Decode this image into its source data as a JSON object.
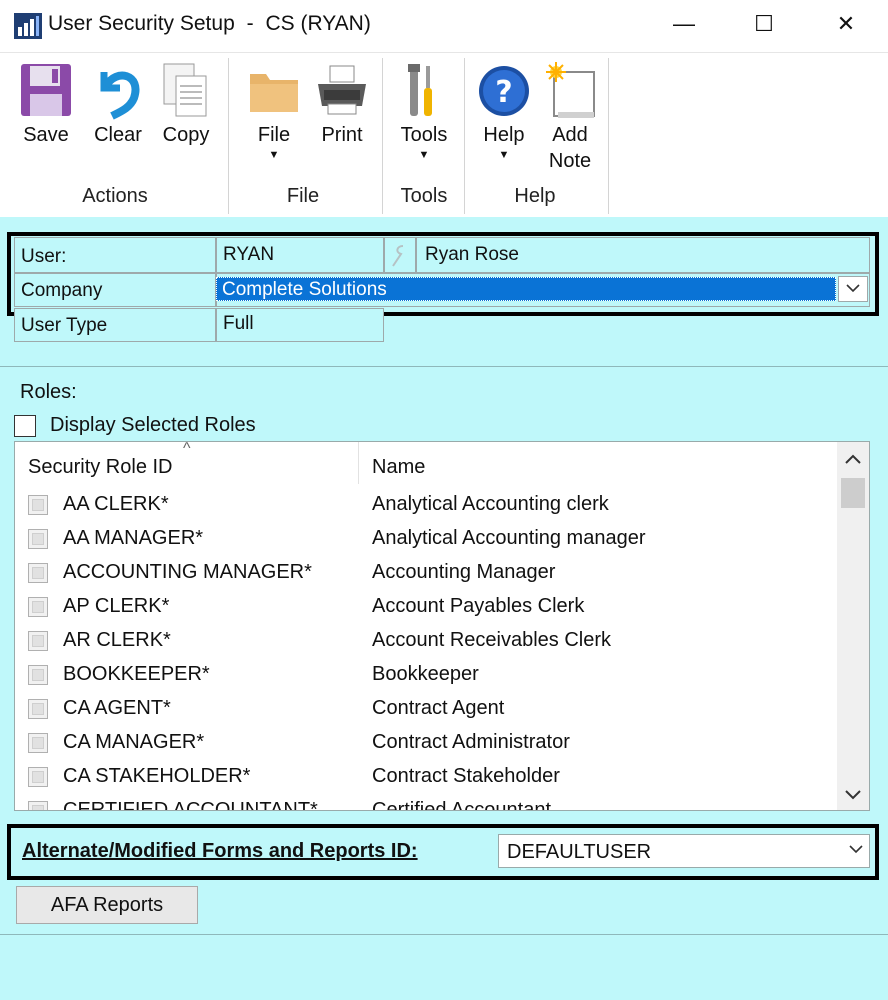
{
  "window": {
    "title": "User Security Setup",
    "title_sep": "-",
    "title_context": "CS (RYAN)",
    "minimize_glyph": "—",
    "maximize_glyph": "☐",
    "close_glyph": "✕"
  },
  "ribbon": {
    "groups": [
      {
        "label": "Actions",
        "buttons": [
          {
            "label": "Save",
            "icon": "floppy-disk-icon"
          },
          {
            "label": "Clear",
            "icon": "undo-arrow-icon"
          },
          {
            "label": "Copy",
            "icon": "copy-pages-icon"
          }
        ]
      },
      {
        "label": "File",
        "buttons": [
          {
            "label": "File",
            "icon": "folder-icon",
            "dropdown": true
          },
          {
            "label": "Print",
            "icon": "printer-icon"
          }
        ]
      },
      {
        "label": "Tools",
        "buttons": [
          {
            "label": "Tools",
            "icon": "tools-icon",
            "dropdown": true
          }
        ]
      },
      {
        "label": "Help",
        "buttons": [
          {
            "label": "Help",
            "icon": "help-icon",
            "dropdown": true
          },
          {
            "label": "Add\nNote",
            "icon": "note-icon"
          }
        ]
      }
    ],
    "caret": "▼"
  },
  "header": {
    "user_label": "User:",
    "user_id": "RYAN",
    "user_name": "Ryan Rose",
    "company_label": "Company",
    "company_value": "Complete Solutions",
    "user_type_label": "User Type",
    "user_type_value": "Full"
  },
  "roles": {
    "label": "Roles:",
    "display_selected_label": "Display Selected Roles",
    "col_id": "Security Role ID",
    "col_name": "Name",
    "sort_glyph": "^",
    "items": [
      {
        "id": "AA CLERK*",
        "name": "Analytical Accounting clerk"
      },
      {
        "id": "AA MANAGER*",
        "name": "Analytical Accounting manager"
      },
      {
        "id": "ACCOUNTING MANAGER*",
        "name": "Accounting Manager"
      },
      {
        "id": "AP CLERK*",
        "name": "Account Payables Clerk"
      },
      {
        "id": "AR CLERK*",
        "name": "Account Receivables Clerk"
      },
      {
        "id": "BOOKKEEPER*",
        "name": "Bookkeeper"
      },
      {
        "id": "CA AGENT*",
        "name": "Contract Agent"
      },
      {
        "id": "CA MANAGER*",
        "name": "Contract Administrator"
      },
      {
        "id": "CA STAKEHOLDER*",
        "name": "Contract Stakeholder"
      },
      {
        "id": "CERTIFIED ACCOUNTANT*",
        "name": "Certified Accountant"
      }
    ]
  },
  "afa": {
    "label": "Alternate/Modified Forms and Reports ID:",
    "value": "DEFAULTUSER",
    "button_label": "AFA Reports"
  },
  "colors": {
    "background": "#bff8fa",
    "selection": "#0a73d6"
  }
}
